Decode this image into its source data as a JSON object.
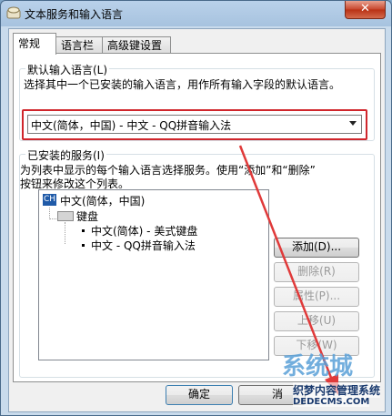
{
  "window": {
    "title": "文本服务和输入语言",
    "close_label": "✕"
  },
  "tabs": [
    {
      "label": "常规",
      "active": true
    },
    {
      "label": "语言栏",
      "active": false
    },
    {
      "label": "高级键设置",
      "active": false
    }
  ],
  "default_language": {
    "group_title": "默认输入语言(L)",
    "description": "选择其中一个已安装的输入语言，用作所有输入字段的默认语言。",
    "selected": "中文(简体，中国) - 中文 - QQ拼音输入法"
  },
  "installed_services": {
    "group_title": "已安装的服务(I)",
    "description_line1": "为列表中显示的每个输入语言选择服务。使用“添加”和“删除”",
    "description_line2": "按钮来修改这个列表。",
    "tree": {
      "language_badge": "CH",
      "language": "中文(简体，中国)",
      "category": "键盘",
      "items": [
        "中文(简体) - 美式键盘",
        "中文 - QQ拼音输入法"
      ]
    },
    "buttons": {
      "add": "添加(D)...",
      "remove": "删除(R)",
      "properties": "属性(P)...",
      "move_up": "上移(U)",
      "move_down": "下移(W)"
    }
  },
  "footer": {
    "ok": "确定",
    "cancel": "消"
  },
  "watermark": {
    "logo": "系统城",
    "text": "织梦内容管理系统",
    "url": "DEDECMS.COM"
  },
  "colors": {
    "highlight_frame": "#d0262c",
    "arrow": "#e03a3a"
  }
}
